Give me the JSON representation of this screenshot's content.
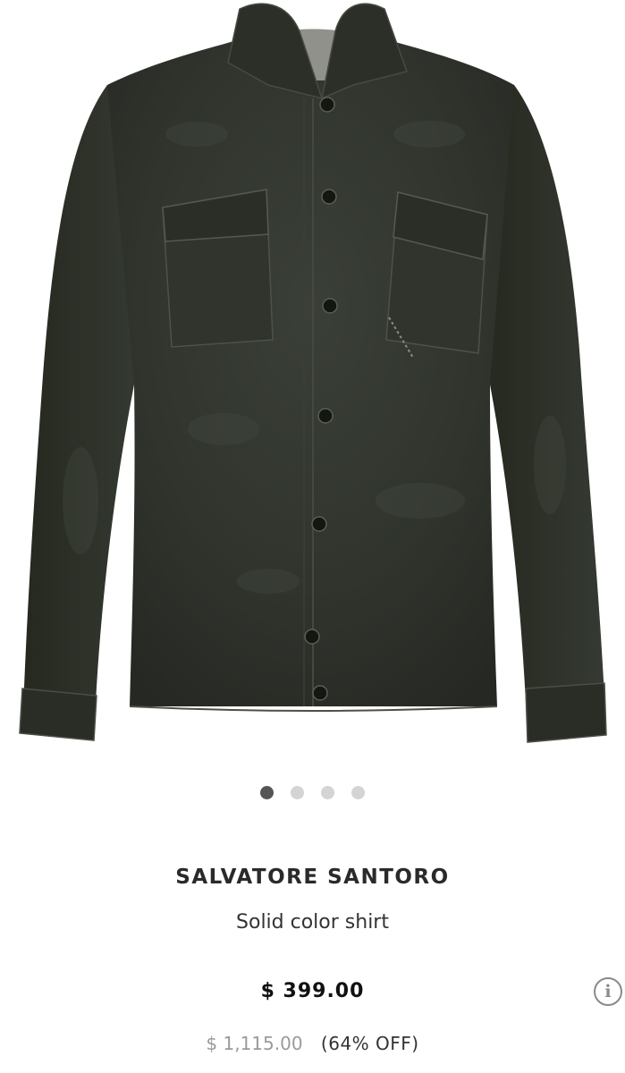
{
  "product_image": {
    "alt": "Solid color shirt",
    "garment_color": "#2f332c"
  },
  "carousel": {
    "dot_count": 4,
    "active_index": 0,
    "active_color": "#555555",
    "inactive_color": "#d4d4d4"
  },
  "product": {
    "brand": "SALVATORE SANTORO",
    "name": "Solid color shirt",
    "price": "$ 399.00",
    "original_price": "$ 1,115.00",
    "discount": "(64% OFF)"
  },
  "icons": {
    "info": "info-icon",
    "info_glyph": "i"
  }
}
